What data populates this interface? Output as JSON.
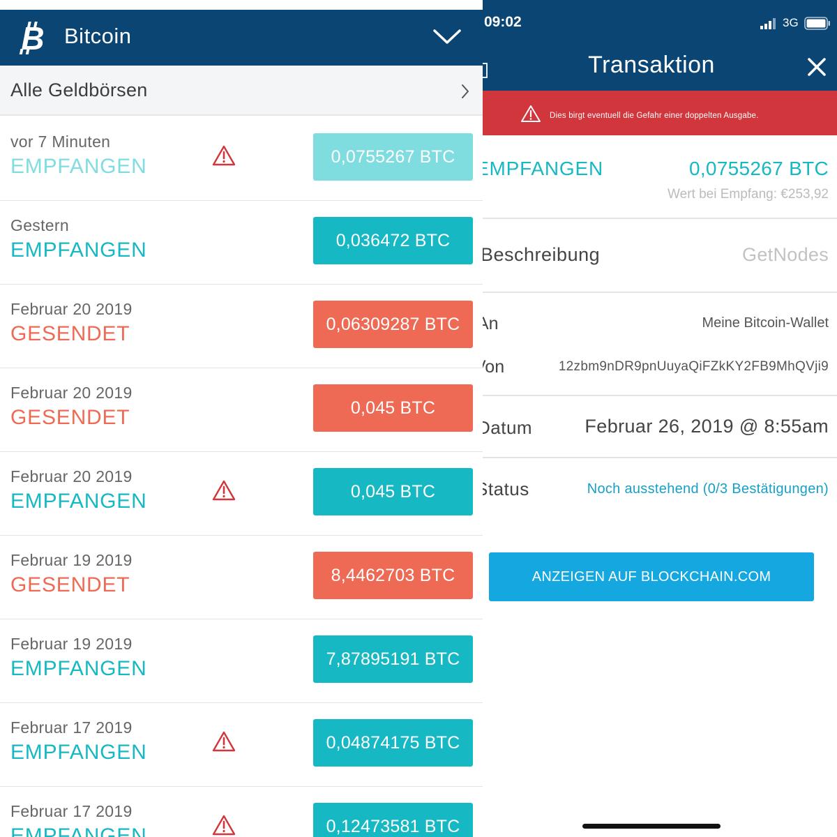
{
  "left": {
    "header": {
      "title": "Bitcoin"
    },
    "wallets_row": {
      "label": "Alle Geldbörsen"
    },
    "transactions": [
      {
        "date": "vor 7 Minuten",
        "direction": "EMPFANGEN",
        "amount": "0,0755267 BTC",
        "warning": true,
        "pending": true
      },
      {
        "date": "Gestern",
        "direction": "EMPFANGEN",
        "amount": "0,036472 BTC",
        "warning": false,
        "pending": false
      },
      {
        "date": "Februar 20 2019",
        "direction": "GESENDET",
        "amount": "0,06309287 BTC",
        "warning": false,
        "pending": false
      },
      {
        "date": "Februar 20 2019",
        "direction": "GESENDET",
        "amount": "0,045 BTC",
        "warning": false,
        "pending": false
      },
      {
        "date": "Februar 20 2019",
        "direction": "EMPFANGEN",
        "amount": "0,045 BTC",
        "warning": true,
        "pending": false
      },
      {
        "date": "Februar 19 2019",
        "direction": "GESENDET",
        "amount": "8,4462703 BTC",
        "warning": false,
        "pending": false
      },
      {
        "date": "Februar 19 2019",
        "direction": "EMPFANGEN",
        "amount": "7,87895191 BTC",
        "warning": false,
        "pending": false
      },
      {
        "date": "Februar 17 2019",
        "direction": "EMPFANGEN",
        "amount": "0,04874175 BTC",
        "warning": true,
        "pending": false
      },
      {
        "date": "Februar 17 2019",
        "direction": "EMPFANGEN",
        "amount": "0,12473581 BTC",
        "warning": true,
        "pending": false
      }
    ]
  },
  "right": {
    "status_bar": {
      "time": "09:02",
      "network": "3G"
    },
    "header": {
      "title": "Transaktion"
    },
    "banner": {
      "text": "Dies birgt eventuell die Gefahr einer doppelten Ausgabe."
    },
    "detail": {
      "direction": "EMPFANGEN",
      "amount": "0,0755267 BTC",
      "value_at_receipt": "Wert bei Empfang: €253,92",
      "description_label": "Beschreibung",
      "description_value": "GetNodes",
      "to_label": "An",
      "to_value": "Meine Bitcoin-Wallet",
      "from_label": "Von",
      "from_value": "12zbm9nDR9pnUuyaQiFZkKY2FB9MhQVji9",
      "date_label": "Datum",
      "date_value": "Februar 26, 2019 @ 8:55am",
      "status_label": "Status",
      "status_value": "Noch ausstehend (0/3 Bestätigungen)"
    },
    "button": {
      "label": "ANZEIGEN AUF BLOCKCHAIN.COM"
    }
  },
  "colors": {
    "header_bg": "#0b4573",
    "received": "#16b8c4",
    "received_pending": "#7fdde0",
    "sent": "#ee6a55",
    "warning_banner": "#d1363c",
    "warning_icon": "#d1363c",
    "link": "#14a7e0"
  },
  "icons": {
    "logo": "bitcoin-logo-icon",
    "header_toggle": "chevron-down-icon",
    "wallets_nav": "chevron-right-icon",
    "warning": "warning-triangle-icon",
    "close": "close-icon",
    "battery": "battery-icon",
    "signal": "signal-icon"
  }
}
